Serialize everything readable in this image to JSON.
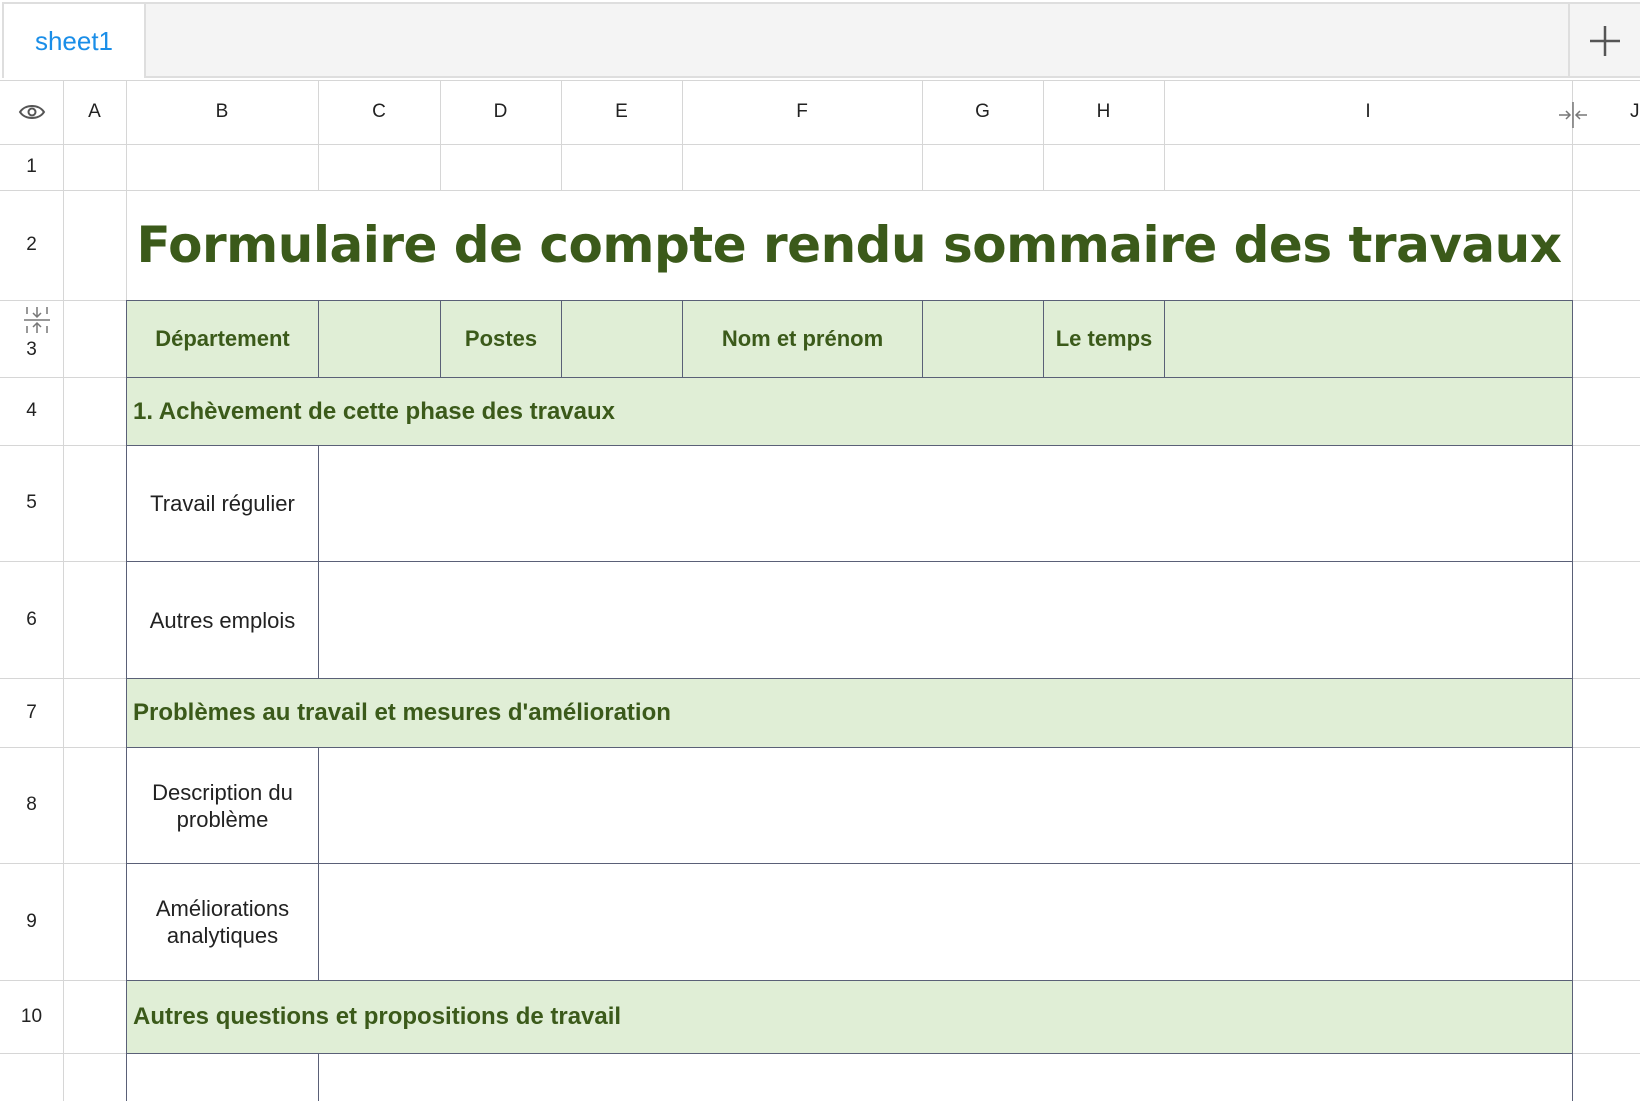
{
  "tabs": [
    {
      "label": "sheet1"
    }
  ],
  "columns": [
    "A",
    "B",
    "C",
    "D",
    "E",
    "F",
    "G",
    "H",
    "I",
    "J"
  ],
  "rows": [
    "1",
    "2",
    "3",
    "4",
    "5",
    "6",
    "7",
    "8",
    "9",
    "10"
  ],
  "form": {
    "title": "Formulaire de compte rendu sommaire des travaux",
    "header": {
      "department": "Département",
      "posts": "Postes",
      "name": "Nom et prénom",
      "time": "Le temps"
    },
    "section1": "1. Achèvement de cette phase des travaux",
    "regular_work": "Travail régulier",
    "other_jobs": "Autres emplois",
    "section2": "Problèmes au travail et mesures d'amélioration",
    "problem_description": "Description du problème",
    "analytical_improvements": "Améliorations analytiques",
    "section3": "Autres questions et propositions de travail"
  },
  "colors": {
    "accent_tab": "#1a8ee8",
    "section_fill": "#e0eed6",
    "section_text": "#3b5a1a",
    "cell_border": "#5a6077"
  },
  "icons": [
    "eye-icon",
    "plus-icon",
    "collapse-columns-icon",
    "collapse-rows-icon"
  ]
}
